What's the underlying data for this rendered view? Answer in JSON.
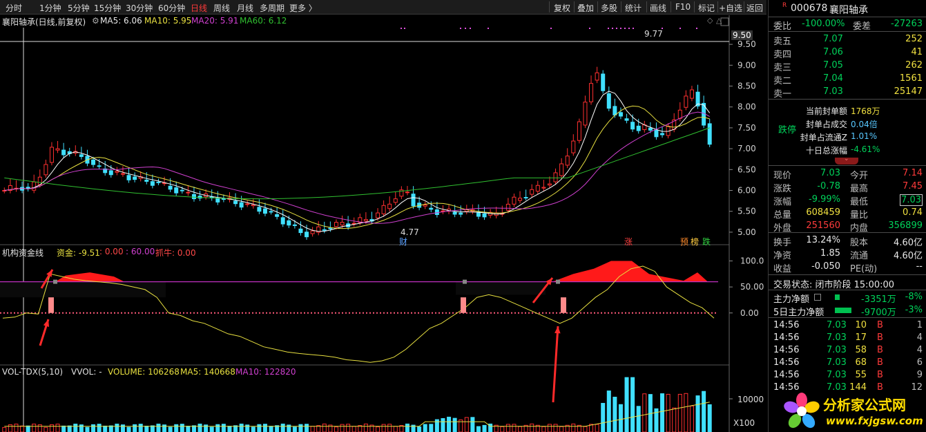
{
  "toolbar": {
    "left": [
      "分时",
      "1分钟",
      "5分钟",
      "15分钟",
      "30分钟",
      "60分钟",
      "日线",
      "周线",
      "月线",
      "多周期",
      "更多 〉"
    ],
    "active": "日线",
    "right": [
      "复权",
      "叠加",
      "多股",
      "统计",
      "画线",
      "F10",
      "标记",
      "+自选",
      "返回"
    ]
  },
  "main_panel": {
    "title": "襄阳轴承(日线,前复权)",
    "ma5": "MA5: 6.06",
    "ma10": "MA10: 5.95",
    "ma20": "MA20: 5.91",
    "ma60": "MA60: 6.12",
    "high_marker": "9.77",
    "low_marker": "4.77",
    "cursor_price": "9.50",
    "tags": {
      "cai": "财",
      "zhang": "涨",
      "yu": "预",
      "bang": "榜",
      "die": "跌"
    }
  },
  "indicator_panel": {
    "title": "机构资金线",
    "fund": "资金: -9.51",
    "v0": ": 0.00",
    "v60": ": 60.00",
    "zhuaniu": "抓牛: 0.00"
  },
  "volume_panel": {
    "title": "VOL-TDX(5,10)",
    "vvol": "VVOL: -",
    "volume": "VOLUME: 106268",
    "ma5": "MA5: 140668",
    "ma10": "MA10: 122820",
    "axis_label": "10000",
    "unit": "X100"
  },
  "chart_data": [
    {
      "type": "candlestick",
      "title": "襄阳轴承(日线,前复权)",
      "y_ticks": [
        "9.50",
        "9.00",
        "8.50",
        "8.00",
        "7.50",
        "7.00",
        "6.50",
        "6.00",
        "5.50",
        "5.00"
      ],
      "ylim": [
        4.7,
        9.9
      ],
      "series": [
        {
          "name": "MA5",
          "color": "#ffffff"
        },
        {
          "name": "MA10",
          "color": "#e8e040"
        },
        {
          "name": "MA20",
          "color": "#d040d0"
        },
        {
          "name": "MA60",
          "color": "#30c030"
        }
      ],
      "high": 9.77,
      "low": 4.77
    },
    {
      "type": "line",
      "title": "机构资金线",
      "y_ticks": [
        "100.0",
        "50.00",
        "0.00"
      ],
      "ylim": [
        -100,
        110
      ]
    },
    {
      "type": "bar",
      "title": "VOL-TDX(5,10)",
      "y_ticks": [
        "10000"
      ],
      "unit": "X100"
    }
  ],
  "quote": {
    "code": "000678",
    "name": "襄阳轴承",
    "weibi_label": "委比",
    "weibi": "-100.00%",
    "weicha_label": "委差",
    "weicha": "-27263",
    "asks": [
      {
        "label": "卖五",
        "price": "7.07",
        "vol": "252"
      },
      {
        "label": "卖四",
        "price": "7.06",
        "vol": "41"
      },
      {
        "label": "卖三",
        "price": "7.05",
        "vol": "262"
      },
      {
        "label": "卖二",
        "price": "7.04",
        "vol": "1561"
      },
      {
        "label": "卖一",
        "price": "7.03",
        "vol": "25147"
      }
    ],
    "limit_down": "跌停",
    "seal": [
      {
        "label": "当前封单额",
        "value": "1768万"
      },
      {
        "label": "封单占成交",
        "value": "0.04倍"
      },
      {
        "label": "封单占流通Z",
        "value": "1.01%"
      },
      {
        "label": "十日总涨幅",
        "value": "-4.61%"
      }
    ],
    "stats": [
      {
        "l1": "现价",
        "v1": "7.03",
        "l2": "今开",
        "v2": "7.14"
      },
      {
        "l1": "涨跌",
        "v1": "-0.78",
        "l2": "最高",
        "v2": "7.45"
      },
      {
        "l1": "涨幅",
        "v1": "-9.99%",
        "l2": "最低",
        "v2": "7.03"
      },
      {
        "l1": "总量",
        "v1": "608459",
        "l2": "量比",
        "v2": "0.74"
      },
      {
        "l1": "外盘",
        "v1": "251560",
        "l2": "内盘",
        "v2": "356899"
      }
    ],
    "stats2": [
      {
        "l1": "换手",
        "v1": "13.24%",
        "l2": "股本",
        "v2": "4.60亿"
      },
      {
        "l1": "净资",
        "v1": "1.85",
        "l2": "流通",
        "v2": "4.60亿"
      },
      {
        "l1": "收益",
        "v1": "-0.050",
        "l2": "PE(动)",
        "v2": "--"
      }
    ],
    "trade_status": "交易状态: 闭市阶段 15:00:00",
    "zhuli": {
      "label": "主力净额",
      "value": "-3351万",
      "pct": "-8%"
    },
    "zhuli5": {
      "label": "5日主力净额",
      "value": "-9700万",
      "pct": "-3%"
    },
    "ticks": [
      {
        "t": "14:56",
        "p": "7.03",
        "v": "10",
        "s": "B",
        "n": "1"
      },
      {
        "t": "14:56",
        "p": "7.03",
        "v": "17",
        "s": "B",
        "n": "4"
      },
      {
        "t": "14:56",
        "p": "7.03",
        "v": "58",
        "s": "B",
        "n": "4"
      },
      {
        "t": "14:56",
        "p": "7.03",
        "v": "68",
        "s": "B",
        "n": "6"
      },
      {
        "t": "14:56",
        "p": "7.03",
        "v": "55",
        "s": "B",
        "n": "9"
      },
      {
        "t": "14:56",
        "p": "7.03",
        "v": "144",
        "s": "B",
        "n": "12"
      }
    ]
  },
  "watermark": {
    "cn": "分析家公式网",
    "url": "www.fxjgsw.com"
  }
}
